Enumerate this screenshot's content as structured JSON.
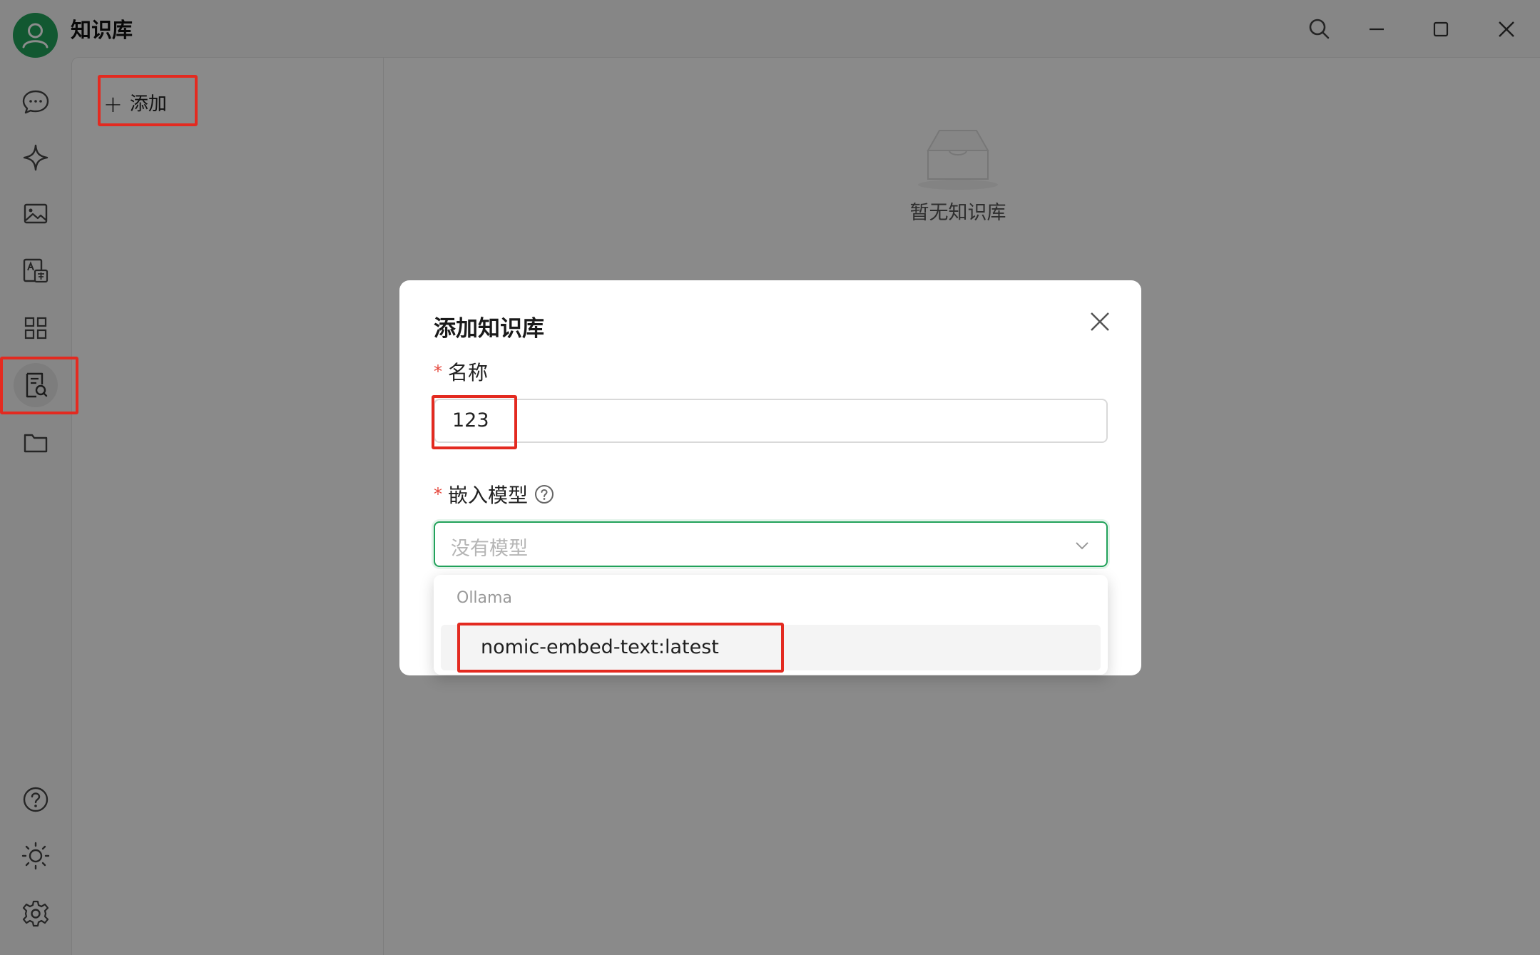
{
  "app": {
    "title": "知识库"
  },
  "sidebar": {
    "items": [
      {
        "name": "chat",
        "icon": "chat-bubble-icon"
      },
      {
        "name": "agents",
        "icon": "sparkle-icon"
      },
      {
        "name": "images",
        "icon": "image-icon"
      },
      {
        "name": "translate",
        "icon": "translate-icon"
      },
      {
        "name": "apps",
        "icon": "grid-icon"
      },
      {
        "name": "knowledge",
        "icon": "knowledge-search-icon",
        "active": true
      },
      {
        "name": "files",
        "icon": "folder-icon"
      }
    ],
    "bottom_items": [
      {
        "name": "help",
        "icon": "help-icon"
      },
      {
        "name": "theme",
        "icon": "sun-icon"
      },
      {
        "name": "settings",
        "icon": "gear-icon"
      }
    ]
  },
  "left_panel": {
    "add_label": "添加",
    "add_icon": "plus-icon"
  },
  "main": {
    "empty_text": "暂无知识库",
    "empty_icon": "empty-inbox-icon"
  },
  "modal": {
    "title": "添加知识库",
    "name_label": "名称",
    "name_value": "123",
    "model_label": "嵌入模型",
    "model_placeholder": "没有模型",
    "required_mark": "*"
  },
  "dropdown": {
    "group": "Ollama",
    "options": [
      "nomic-embed-text:latest"
    ]
  },
  "colors": {
    "accent": "#22a25b",
    "highlight": "#e32a20",
    "required": "#e5483d"
  }
}
